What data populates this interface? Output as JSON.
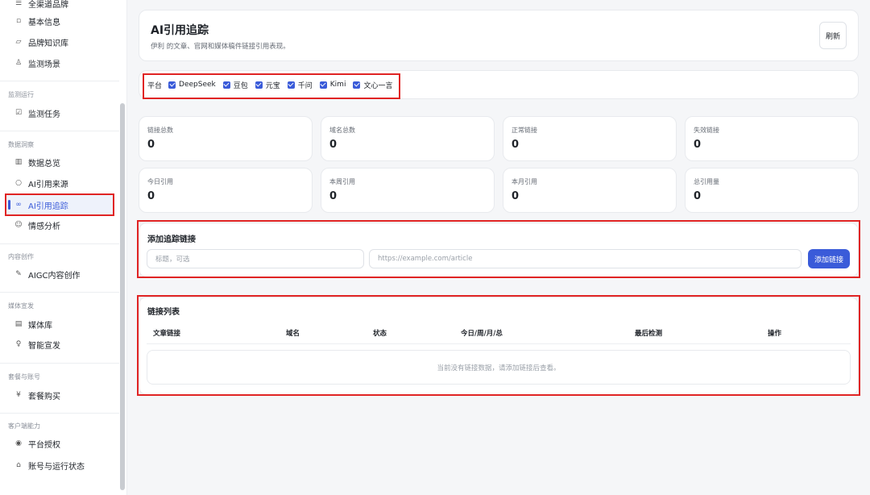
{
  "sidebar": {
    "top_partial_label": "全渠道品牌",
    "items": [
      {
        "label": "基本信息",
        "icon": "square-icon"
      },
      {
        "label": "品牌知识库",
        "icon": "folder-icon"
      },
      {
        "label": "监测场景",
        "icon": "person-icon"
      }
    ],
    "groups": [
      {
        "label": "监测运行",
        "items": [
          {
            "label": "监测任务",
            "icon": "checkbox-icon"
          }
        ]
      },
      {
        "label": "数据洞察",
        "items": [
          {
            "label": "数据总览",
            "icon": "grid-icon"
          },
          {
            "label": "AI引用来源",
            "icon": "circle-icon"
          },
          {
            "label": "AI引用追踪",
            "icon": "link-icon",
            "active": true
          },
          {
            "label": "情感分析",
            "icon": "smile-icon"
          }
        ]
      },
      {
        "label": "内容创作",
        "items": [
          {
            "label": "AIGC内容创作",
            "icon": "pen-icon"
          }
        ]
      },
      {
        "label": "媒体宣发",
        "items": [
          {
            "label": "媒体库",
            "icon": "list-icon"
          },
          {
            "label": "智能宣发",
            "icon": "bulb-icon"
          }
        ]
      },
      {
        "label": "套餐与账号",
        "items": [
          {
            "label": "套餐购买",
            "icon": "yen-icon"
          }
        ]
      },
      {
        "label": "客户端能力",
        "items": [
          {
            "label": "平台授权",
            "icon": "radio-icon"
          },
          {
            "label": "账号与运行状态",
            "icon": "home-icon"
          }
        ]
      }
    ]
  },
  "header": {
    "title": "AI引用追踪",
    "subtitle": "伊利 的文章、官网和媒体稿件链接引用表现。",
    "refresh_label": "刷新"
  },
  "platforms": {
    "label": "平台",
    "options": [
      "DeepSeek",
      "豆包",
      "元宝",
      "千问",
      "Kimi",
      "文心一言"
    ]
  },
  "stats": [
    {
      "label": "链接总数",
      "value": "0"
    },
    {
      "label": "域名总数",
      "value": "0"
    },
    {
      "label": "正常链接",
      "value": "0"
    },
    {
      "label": "失效链接",
      "value": "0"
    },
    {
      "label": "今日引用",
      "value": "0"
    },
    {
      "label": "本周引用",
      "value": "0"
    },
    {
      "label": "本月引用",
      "value": "0"
    },
    {
      "label": "总引用量",
      "value": "0"
    }
  ],
  "add_link": {
    "title": "添加追踪链接",
    "title_placeholder": "标题，可选",
    "url_placeholder": "https://example.com/article",
    "button_label": "添加链接"
  },
  "link_list": {
    "title": "链接列表",
    "columns": [
      "文章链接",
      "域名",
      "状态",
      "今日/周/月/总",
      "最后检测",
      "操作"
    ],
    "empty_text": "当前没有链接数据，请添加链接后查看。"
  },
  "colors": {
    "accent": "#3a5bd9",
    "highlight": "#e02424"
  }
}
